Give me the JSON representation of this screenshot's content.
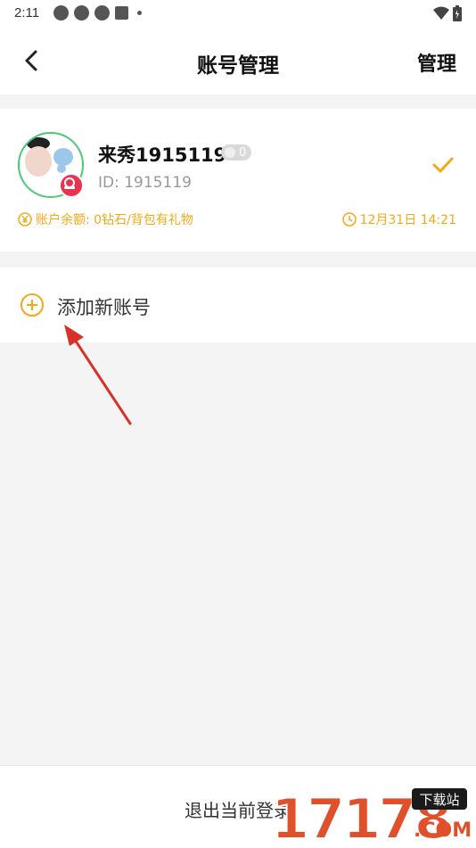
{
  "status_bar": {
    "time": "2:11"
  },
  "nav": {
    "title": "账号管理",
    "manage_label": "管理"
  },
  "account": {
    "name": "来秀1915119",
    "level": "0",
    "id_text": "ID: 1915119",
    "balance_text": "账户余额: 0钻石/背包有礼物",
    "time_text": "12月31日 14:21",
    "selected": true
  },
  "add_account": {
    "label": "添加新账号"
  },
  "logout": {
    "label": "退出当前登录"
  },
  "watermark": {
    "text": "17178",
    "badge": "下载站",
    "suffix": ".COM"
  },
  "colors": {
    "accent": "#f3a81a",
    "avatar_ring": "#4fc67a",
    "badge": "#e8344e",
    "arrow": "#d8302a"
  }
}
